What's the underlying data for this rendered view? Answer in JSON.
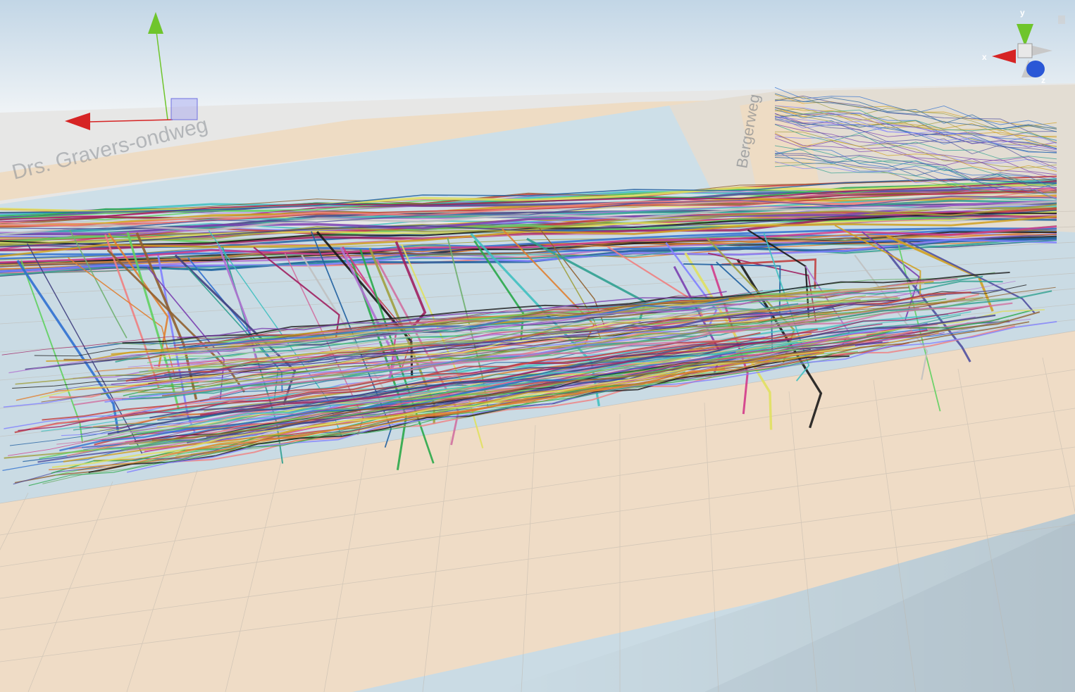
{
  "view": {
    "type": "3d-scene-view",
    "sky_top": "#c6d8e6",
    "sky_horizon": "#eef3f6",
    "sea_color": "#c9dce6",
    "sand_color": "#efdcc6",
    "grid_color": "#b8b2aa"
  },
  "gizmo": {
    "labels": {
      "y": "y",
      "x": "x",
      "z": "z"
    },
    "colors": {
      "y": "#6fc52c",
      "x": "#d62424",
      "z": "#2a57d6",
      "neutral": "#c8c8c8"
    }
  },
  "move_handle": {
    "colors": {
      "y": "#6fc52c",
      "x": "#d62424",
      "plane": "#8c8cf0"
    }
  },
  "map": {
    "labels": [
      "Drs. Gravers-ondweg",
      "Bergerweg"
    ]
  },
  "trajectories": {
    "palette": [
      "#7a3fb0",
      "#2aa84a",
      "#e08030",
      "#3070d0",
      "#d23a8a",
      "#1a1a1a",
      "#a0a040",
      "#40c0c0",
      "#c04040",
      "#8080ff",
      "#60d060",
      "#b070d0",
      "#d0a020",
      "#404080",
      "#f08080",
      "#30a090",
      "#906030",
      "#c0c0c0",
      "#5050a0",
      "#e0e060",
      "#a02060",
      "#2060a0",
      "#70b070",
      "#d070a0"
    ]
  }
}
